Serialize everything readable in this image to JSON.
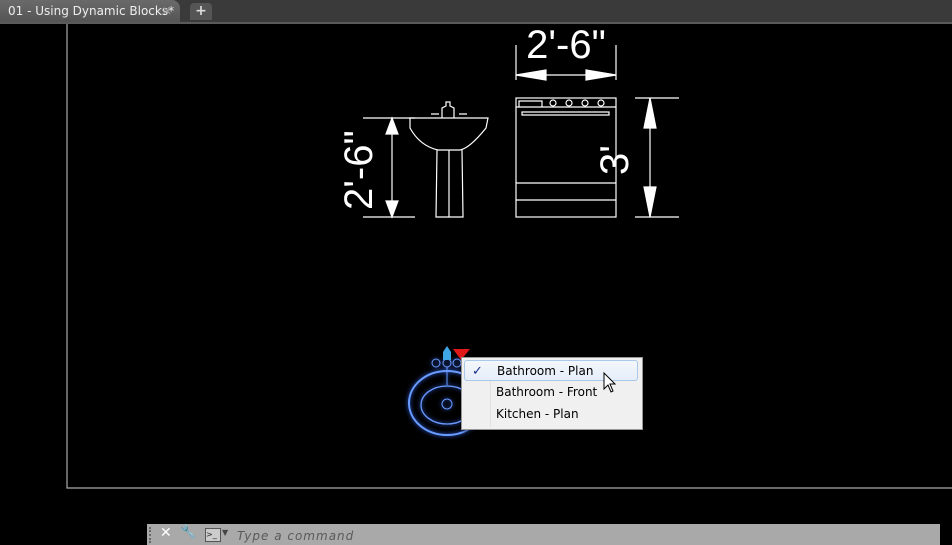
{
  "tabs": [
    {
      "label": "01 - Using Dynamic Blocks*",
      "active": true
    }
  ],
  "new_tab_label": "+",
  "drawing": {
    "dim_sink_height": "2'-6\"",
    "dim_range_width": "2'-6\"",
    "dim_range_height": "3'",
    "selection_color": "#3a6cff"
  },
  "context_menu": {
    "items": [
      {
        "label": "Bathroom - Plan",
        "checked": true
      },
      {
        "label": "Bathroom - Front",
        "checked": false
      },
      {
        "label": "Kitchen - Plan",
        "checked": false
      }
    ],
    "check_glyph": "✓"
  },
  "command_line": {
    "placeholder": "Type a command",
    "prompt_glyph": ">_"
  }
}
